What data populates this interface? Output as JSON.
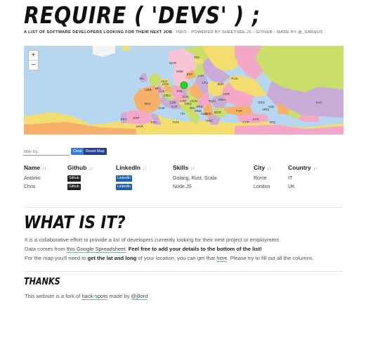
{
  "header": {
    "title": "REQUIRE ( 'DEVS' ) ;",
    "tagline": "A list of software developers looking for their next job",
    "links": [
      {
        "label": "Info"
      },
      {
        "label": "Powered by Sheetsee.js"
      },
      {
        "label": "Github"
      },
      {
        "label": "Made by @_sarhus"
      }
    ],
    "separator": "-"
  },
  "map": {
    "zoom_in": "+",
    "zoom_out": "−",
    "country_labels": [
      "GBR",
      "IRL",
      "FRA",
      "BEL",
      "NLD",
      "DEU",
      "DNK",
      "NOR",
      "SWE",
      "FIN",
      "POL",
      "CZE",
      "AUT",
      "CHE",
      "ITA",
      "ESP",
      "PRT",
      "HRV",
      "SRB",
      "HUN",
      "ROU",
      "BGR",
      "GRC",
      "TUR",
      "UKR",
      "BLR",
      "LTU",
      "LVA",
      "EST",
      "RUS",
      "SVK",
      "ALB",
      "MKD",
      "MDA",
      "SYR",
      "IRQ",
      "TUN",
      "DZA",
      "MAR",
      "KAZ",
      "GEO",
      "AZE",
      "ARM",
      "CYP",
      "SVN",
      "BIH",
      "MNE",
      "LUX"
    ],
    "colors": {
      "sea": "#b6d7ef",
      "land_default": "#f3dd6e",
      "marker": "#27d227"
    }
  },
  "filter": {
    "placeholder": "filter by..",
    "clear_label": "Clear",
    "reset_label": "Reset Map"
  },
  "table": {
    "sort_glyph": "↓↑",
    "columns": [
      "Name",
      "Github",
      "LinkedIn",
      "Skills",
      "City",
      "Country"
    ],
    "rows": [
      {
        "name": "Antonio",
        "github": "Github",
        "linkedin": "LinkedIn",
        "skills": "Golang, Rust, Scala",
        "city": "Rome",
        "country": "IT"
      },
      {
        "name": "Chris",
        "github": "Github",
        "linkedin": "LinkedIn",
        "skills": "Node.JS",
        "city": "London",
        "country": "UK"
      }
    ]
  },
  "what": {
    "heading": "WHAT IS IT?",
    "p1": "It is a collaborative effort to provide a list of developers currently looking for their next project or employment.",
    "p2_a": "Data comes from ",
    "p2_link": "this Google Spreadsheet",
    "p2_b": ". ",
    "p2_strong": "Feel free to add your details to the bottom of the list!",
    "p3_a": "For the map you'll need to ",
    "p3_strong": "get the lat and long",
    "p3_b": " of your location, you can get that ",
    "p3_link": "here",
    "p3_c": ". Please try to fill out all the columns."
  },
  "thanks": {
    "heading": "THANKS",
    "text_a": "This website is a fork of ",
    "link1": "hack-spots",
    "text_b": " made by ",
    "link2": "@jllord"
  }
}
